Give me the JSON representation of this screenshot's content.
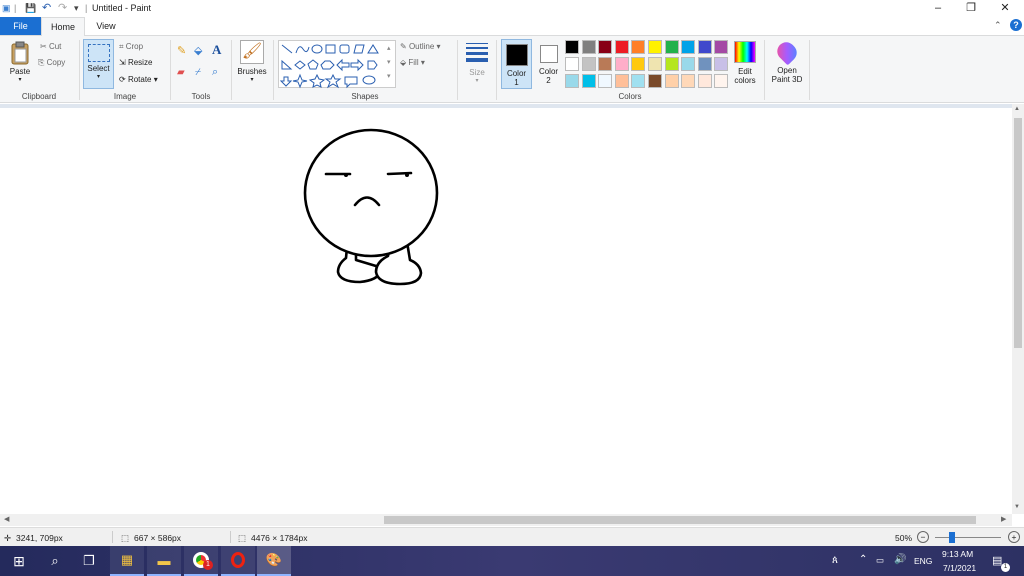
{
  "window": {
    "title": "Untitled - Paint",
    "minimize": "–",
    "restore": "❐",
    "close": "✕",
    "help": "?"
  },
  "tabs": {
    "file": "File",
    "home": "Home",
    "view": "View"
  },
  "ribbon": {
    "clipboard": {
      "paste": "Paste",
      "cut": "Cut",
      "copy": "Copy",
      "group": "Clipboard"
    },
    "image": {
      "select": "Select",
      "crop": "Crop",
      "resize": "Resize",
      "rotate": "Rotate",
      "group": "Image"
    },
    "tools": {
      "group": "Tools"
    },
    "brushes": {
      "label": "Brushes"
    },
    "shapes": {
      "outline": "Outline",
      "fill": "Fill",
      "group": "Shapes"
    },
    "size": {
      "label": "Size"
    },
    "colors": {
      "color1": "Color\n1",
      "color1_a": "Color",
      "color1_b": "1",
      "color2_a": "Color",
      "color2_b": "2",
      "edit_a": "Edit",
      "edit_b": "colors",
      "group": "Colors",
      "palette": [
        "#000000",
        "#7f7f7f",
        "#880015",
        "#ed1c24",
        "#ff7f27",
        "#fff200",
        "#22b14c",
        "#00a2e8",
        "#3f48cc",
        "#a349a4",
        "#ffffff",
        "#c3c3c3",
        "#b97a57",
        "#ffaec9",
        "#ffc90e",
        "#efe4b0",
        "#b5e61d",
        "#99d9ea",
        "#7092be",
        "#c8bfe7",
        "#99d9ea",
        "#00bfe8",
        "#f0f8ff",
        "#ffbf99",
        "#a0e0f0",
        "#7a4a2a",
        "#ffd0a8",
        "#ffd8b8",
        "#ffe8dc",
        "#fff4ee"
      ]
    },
    "paint3d_a": "Open",
    "paint3d_b": "Paint 3D"
  },
  "status": {
    "cursor": "3241, 709px",
    "selection": "667 × 586px",
    "image_size": "4476 × 1784px",
    "zoom": "50%"
  },
  "taskbar": {
    "lang": "ENG",
    "time": "9:13 AM",
    "date": "7/1/2021",
    "badge": "1",
    "notif": "1"
  }
}
